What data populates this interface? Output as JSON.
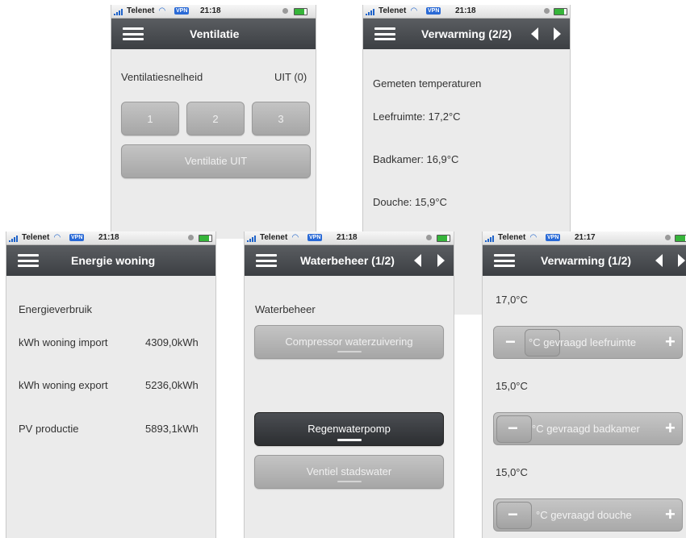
{
  "status": {
    "carrier": "Telenet",
    "vpn": "VPN"
  },
  "ventilatie": {
    "time": "21:18",
    "title": "Ventilatie",
    "speed_label": "Ventilatiesnelheid",
    "speed_value": "UIT (0)",
    "buttons": [
      "1",
      "2",
      "3"
    ],
    "off_button": "Ventilatie UIT"
  },
  "verwarming2": {
    "time": "21:18",
    "title": "Verwarming (2/2)",
    "heading": "Gemeten temperaturen",
    "rows": [
      "Leefruimte: 17,2°C",
      "Badkamer: 16,9°C",
      "Douche: 15,9°C"
    ]
  },
  "energie": {
    "time": "21:18",
    "title": "Energie woning",
    "heading": "Energieverbruik",
    "rows": [
      {
        "label": "kWh woning import",
        "value": "4309,0kWh"
      },
      {
        "label": "kWh woning export",
        "value": "5236,0kWh"
      },
      {
        "label": "PV productie",
        "value": "5893,1kWh"
      }
    ]
  },
  "waterbeheer": {
    "time": "21:18",
    "title": "Waterbeheer (1/2)",
    "heading": "Waterbeheer",
    "buttons": [
      "Compressor waterzuivering",
      "Regenwaterpomp",
      "Ventiel stadswater"
    ]
  },
  "verwarming1": {
    "time": "21:17",
    "title": "Verwarming (1/2)",
    "items": [
      {
        "value": "17,0°C",
        "label": "°C gevraagd leefruimte"
      },
      {
        "value": "15,0°C",
        "label": "°C gevraagd badkamer"
      },
      {
        "value": "15,0°C",
        "label": "°C gevraagd douche"
      }
    ]
  },
  "colors": {
    "navbar": "#44474b",
    "background": "#ebebeb",
    "button": "#b4b4b4",
    "button_active": "#35383c"
  }
}
